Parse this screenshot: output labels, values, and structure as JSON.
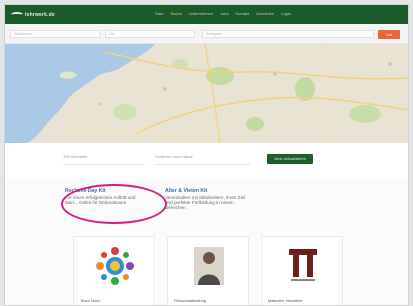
{
  "nav": {
    "logo_text": "lehrwerk.de",
    "items": [
      {
        "label": "Start"
      },
      {
        "label": "Suche"
      },
      {
        "label": "Unternehmen"
      },
      {
        "label": "Jobs"
      },
      {
        "label": "Kontakt"
      },
      {
        "label": "Anmelden"
      },
      {
        "label": "Login"
      }
    ],
    "active_index": 1
  },
  "search": {
    "field1_placeholder": "Stichworte",
    "field2_placeholder": "Ort",
    "field3_placeholder": "Kategorie",
    "button_label": "Los"
  },
  "filters": {
    "dropdown1": "100 Kilometer",
    "dropdown2": "Sortieren nach Name",
    "button_label": "Jetzt aktualisieren"
  },
  "entries": [
    {
      "title": "Reclame Day Kit",
      "desc": "Für einen erfolgreichen Auftritt und Mari... Geleit für Dekorationen"
    },
    {
      "title": "Alter & Vieten Kit",
      "desc": "Veranstalten mit Mitarbeitern, Ihren Ziel und perfekte Fortbildung in neuen Bereichen"
    }
  ],
  "cards": [
    {
      "title": "Team Nord"
    },
    {
      "title": "Personalabteilung"
    },
    {
      "title": "Makerele Hersteller"
    }
  ],
  "colors": {
    "nav_bg": "#1b5a2b",
    "accent_orange": "#e8673a",
    "action_green": "#1f5d2d",
    "link_blue": "#3b6fa3",
    "highlight_magenta": "#d81b85"
  }
}
